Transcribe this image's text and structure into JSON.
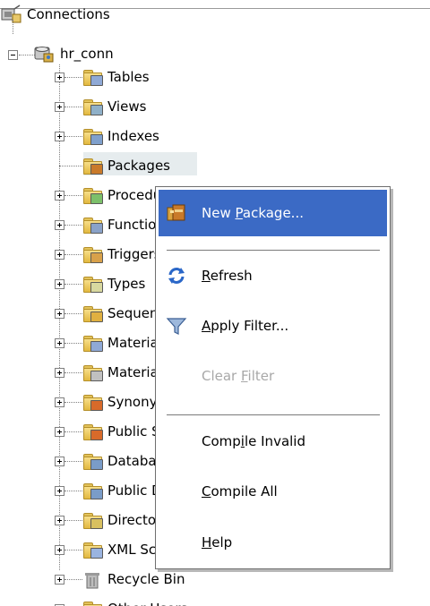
{
  "tree": {
    "root_label": "Connections",
    "connection_label": "hr_conn",
    "nodes": [
      {
        "label": "Tables",
        "icon": "table-folder-icon"
      },
      {
        "label": "Views",
        "icon": "view-folder-icon"
      },
      {
        "label": "Indexes",
        "icon": "index-folder-icon"
      },
      {
        "label": "Packages",
        "icon": "package-folder-icon"
      },
      {
        "label": "Procedures",
        "icon": "procedure-folder-icon"
      },
      {
        "label": "Functions",
        "icon": "function-folder-icon"
      },
      {
        "label": "Triggers",
        "icon": "trigger-folder-icon"
      },
      {
        "label": "Types",
        "icon": "type-folder-icon"
      },
      {
        "label": "Sequences",
        "icon": "sequence-folder-icon"
      },
      {
        "label": "Materialized Views",
        "icon": "materialized-view-folder-icon"
      },
      {
        "label": "Materialized View Logs",
        "icon": "materialized-view-log-folder-icon"
      },
      {
        "label": "Synonyms",
        "icon": "synonym-folder-icon"
      },
      {
        "label": "Public Synonyms",
        "icon": "public-synonym-folder-icon"
      },
      {
        "label": "Database Links",
        "icon": "database-link-folder-icon"
      },
      {
        "label": "Public Database Links",
        "icon": "public-database-link-folder-icon"
      },
      {
        "label": "Directories",
        "icon": "directory-folder-icon"
      },
      {
        "label": "XML Schemas",
        "icon": "xml-schema-folder-icon"
      },
      {
        "label": "Recycle Bin",
        "icon": "recycle-bin-icon"
      },
      {
        "label": "Other Users",
        "icon": "other-users-folder-icon"
      }
    ]
  },
  "context_menu": {
    "items": [
      {
        "pre": "New ",
        "mn": "P",
        "post": "ackage...",
        "state": "highlighted"
      },
      {
        "pre": "",
        "mn": "R",
        "post": "efresh",
        "state": "enabled"
      },
      {
        "pre": "",
        "mn": "A",
        "post": "pply Filter...",
        "state": "enabled"
      },
      {
        "pre": "Clear ",
        "mn": "F",
        "post": "ilter",
        "state": "disabled"
      },
      {
        "pre": "Comp",
        "mn": "i",
        "post": "le Invalid",
        "state": "enabled"
      },
      {
        "pre": "",
        "mn": "C",
        "post": "ompile All",
        "state": "enabled"
      },
      {
        "pre": "",
        "mn": "H",
        "post": "elp",
        "state": "enabled"
      }
    ]
  },
  "colors": {
    "highlight": "#3b6ac5",
    "selected_node_bg": "#e6ecee",
    "folder": "#e2b83f",
    "disabled_text": "#a8a8a8"
  }
}
